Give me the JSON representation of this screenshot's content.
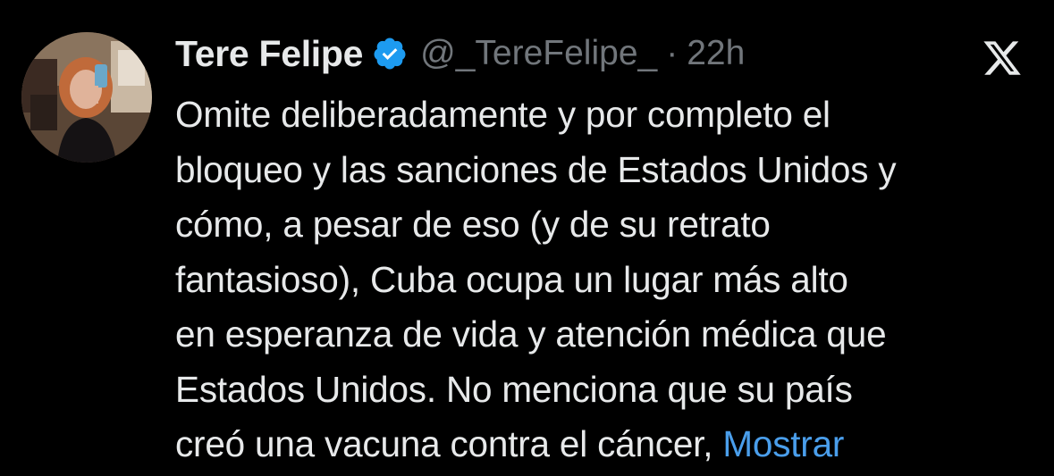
{
  "tweet": {
    "author": {
      "display_name": "Tere Felipe",
      "verified": true,
      "handle": "@_TereFelipe_",
      "separator": "·",
      "time": "22h"
    },
    "text_lines": [
      "Omite deliberadamente y por completo el",
      "bloqueo y las sanciones de Estados Unidos y",
      "cómo, a pesar de eso (y de su retrato",
      "fantasioso), Cuba ocupa un lugar más alto",
      "en esperanza de vida y atención médica que",
      "Estados Unidos. No menciona que su país",
      "creó una vacuna contra el cáncer,"
    ],
    "show_more": "Mostrar",
    "icons": {
      "verified": "verified-badge-icon",
      "platform": "x-logo-icon"
    },
    "colors": {
      "background": "#000000",
      "text": "#e7e9ea",
      "secondary": "#71767b",
      "link": "#4a9eeb",
      "verified": "#1d9bf0"
    }
  }
}
